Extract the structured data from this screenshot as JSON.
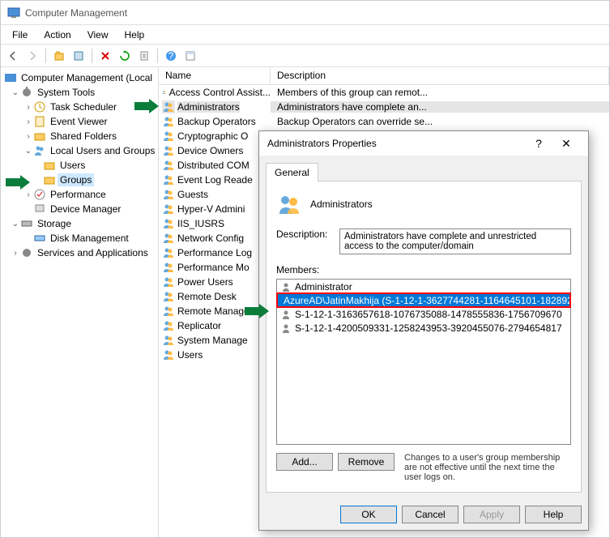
{
  "window": {
    "title": "Computer Management"
  },
  "menu": {
    "file": "File",
    "action": "Action",
    "view": "View",
    "help": "Help"
  },
  "tree": {
    "root": "Computer Management (Local",
    "systools": "System Tools",
    "tasksched": "Task Scheduler",
    "evtviewer": "Event Viewer",
    "sharedf": "Shared Folders",
    "lusers": "Local Users and Groups",
    "users": "Users",
    "groups": "Groups",
    "perf": "Performance",
    "devmgr": "Device Manager",
    "storage": "Storage",
    "diskmgmt": "Disk Management",
    "services": "Services and Applications"
  },
  "columns": {
    "name": "Name",
    "desc": "Description"
  },
  "groups": [
    {
      "n": "Access Control Assist...",
      "d": "Members of this group can remot..."
    },
    {
      "n": "Administrators",
      "d": "Administrators have complete an..."
    },
    {
      "n": "Backup Operators",
      "d": "Backup Operators can override se..."
    },
    {
      "n": "Cryptographic O",
      "d": ""
    },
    {
      "n": "Device Owners",
      "d": ""
    },
    {
      "n": "Distributed COM",
      "d": ""
    },
    {
      "n": "Event Log Reade",
      "d": ""
    },
    {
      "n": "Guests",
      "d": ""
    },
    {
      "n": "Hyper-V Admini",
      "d": ""
    },
    {
      "n": "IIS_IUSRS",
      "d": ""
    },
    {
      "n": "Network Config",
      "d": ""
    },
    {
      "n": "Performance Log",
      "d": ""
    },
    {
      "n": "Performance Mo",
      "d": ""
    },
    {
      "n": "Power Users",
      "d": ""
    },
    {
      "n": "Remote Desk",
      "d": ""
    },
    {
      "n": "Remote Manage",
      "d": ""
    },
    {
      "n": "Replicator",
      "d": ""
    },
    {
      "n": "System Manage",
      "d": ""
    },
    {
      "n": "Users",
      "d": ""
    }
  ],
  "dialog": {
    "title": "Administrators Properties",
    "tab": "General",
    "groupName": "Administrators",
    "descLabel": "Description:",
    "descValue": "Administrators have complete and unrestricted access to the computer/domain",
    "membersLabel": "Members:",
    "members": [
      "Administrator",
      "AzureAD\\JatinMakhija (S-1-12-1-3627744281-1164645101-182892...",
      "S-1-12-1-3163657618-1076735088-1478555836-1756709670",
      "S-1-12-1-4200509331-1258243953-3920455076-2794654817"
    ],
    "add": "Add...",
    "remove": "Remove",
    "note": "Changes to a user's group membership are not effective until the next time the user logs on.",
    "ok": "OK",
    "cancel": "Cancel",
    "apply": "Apply",
    "help": "Help"
  }
}
